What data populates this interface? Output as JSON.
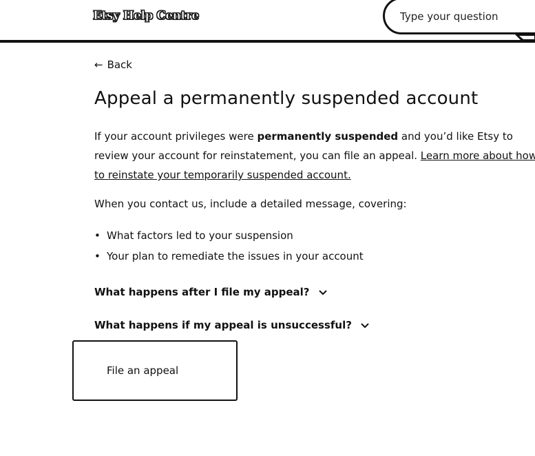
{
  "header": {
    "logo_text": "Etsy Help Centre",
    "search_placeholder": "Type your question"
  },
  "nav": {
    "back_label": "Back"
  },
  "article": {
    "title": "Appeal a permanently suspended account",
    "intro_part1": "If your account privileges were ",
    "intro_bold": "permanently suspended",
    "intro_part2": " and you’d like Etsy to review your account for reinstatement, you can file an appeal. ",
    "intro_link": "Learn more about how to reinstate your temporarily suspended account.",
    "contact_text": "When you contact us, include a detailed message, covering:",
    "bullets": [
      "What factors led to your suspension",
      "Your plan to remediate the issues in your account"
    ],
    "faqs": [
      "What happens after I file my appeal?",
      "What happens if my appeal is unsuccessful?"
    ],
    "cta_label": "File an appeal"
  }
}
